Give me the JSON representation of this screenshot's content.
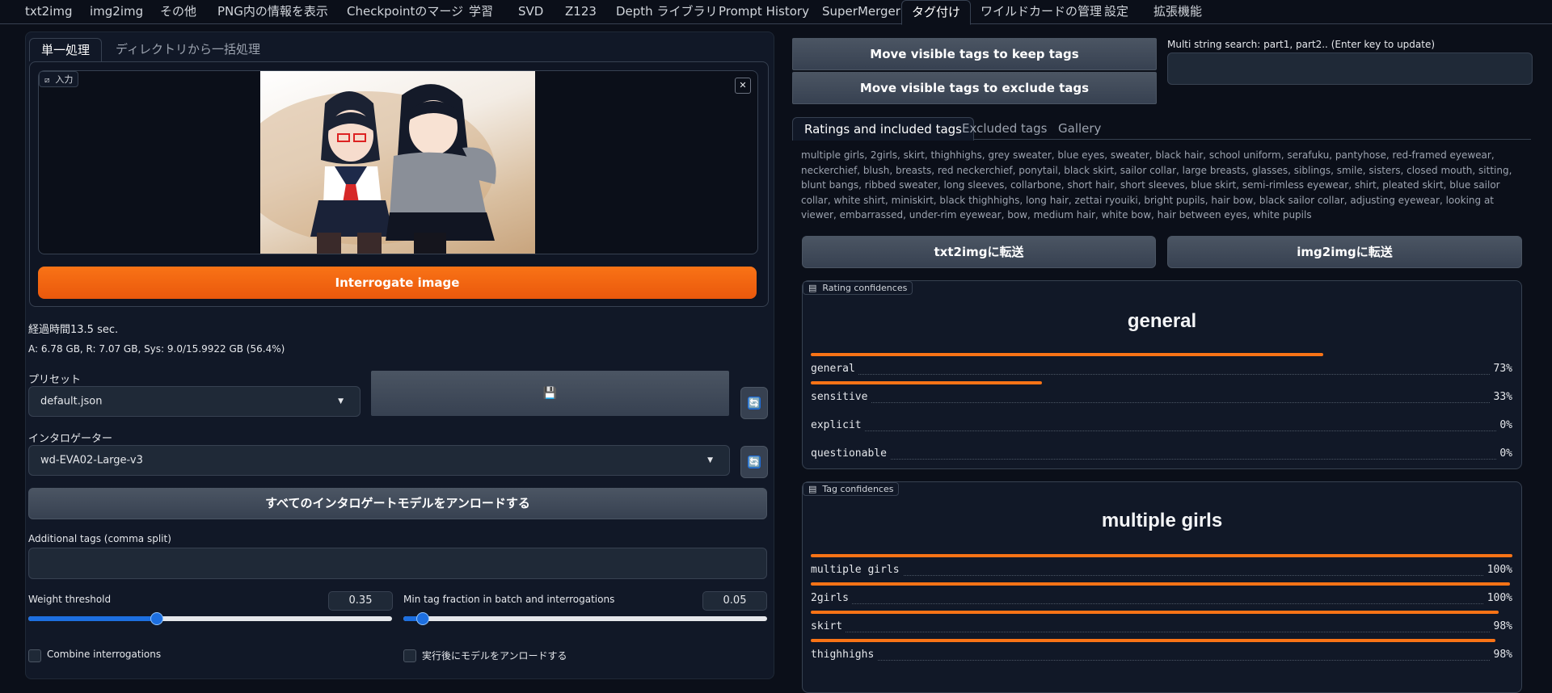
{
  "nav": {
    "tabs": [
      "txt2img",
      "img2img",
      "その他",
      "PNG内の情報を表示",
      "Checkpointのマージ",
      "学習",
      "SVD",
      "Z123",
      "Depth ライブラリ",
      "Prompt History",
      "SuperMerger",
      "タグ付け",
      "ワイルドカードの管理",
      "設定",
      "拡張機能"
    ],
    "active": "タグ付け"
  },
  "left": {
    "subtabs": [
      "単一処理",
      "ディレクトリから一括処理"
    ],
    "image_label": "入力",
    "image_close": "✕",
    "interrogate": "Interrogate image",
    "elapsed": "経過時間13.5 sec.",
    "mem": "A: 6.78 GB, R: 7.07 GB, Sys: 9.0/15.9922 GB (56.4%)",
    "preset_label": "プリセット",
    "preset_value": "default.json",
    "save_icon": "💾",
    "interrogator_label": "インタロゲーター",
    "interrogator_value": "wd-EVA02-Large-v3",
    "refresh_icon": "🔄",
    "unload_all": "すべてのインタロゲートモデルをアンロードする",
    "additional_tags_label": "Additional tags (comma split)",
    "weight_label": "Weight threshold",
    "weight_value": "0.35",
    "weight_level": 0.35,
    "min_frac_label": "Min tag fraction in batch and interrogations",
    "min_frac_value": "0.05",
    "min_frac_level": 0.05,
    "combine_label": "Combine interrogations",
    "unload_after_label": "実行後にモデルをアンロードする"
  },
  "right": {
    "move_keep": "Move visible tags to keep tags",
    "move_exclude": "Move visible tags to exclude tags",
    "search_label": "Multi string search: part1, part2.. (Enter key to update)",
    "tabs": [
      "Ratings and included tags",
      "Excluded tags",
      "Gallery"
    ],
    "tags_text": "multiple girls, 2girls, skirt, thighhighs, grey sweater, blue eyes, sweater, black hair, school uniform, serafuku, pantyhose, red-framed eyewear, neckerchief, blush, breasts, red neckerchief, ponytail, black skirt, sailor collar, large breasts, glasses, siblings, smile, sisters, closed mouth, sitting, blunt bangs, ribbed sweater, long sleeves, collarbone, short hair, short sleeves, blue skirt, semi-rimless eyewear, shirt, pleated skirt, blue sailor collar, white shirt, miniskirt, black thighhighs, long hair, zettai ryouiki, bright pupils, hair bow, black sailor collar, adjusting eyewear, looking at viewer, embarrassed, under-rim eyewear, bow, medium hair, white bow, hair between eyes, white pupils",
    "to_txt2img": "txt2imgに転送",
    "to_img2img": "img2imgに転送",
    "rating": {
      "label": "Rating confidences",
      "top": "general",
      "rows": [
        {
          "name": "general",
          "pct": "73%",
          "value": 0.73
        },
        {
          "name": "sensitive",
          "pct": "33%",
          "value": 0.33
        },
        {
          "name": "explicit",
          "pct": "0%",
          "value": 0.0
        },
        {
          "name": "questionable",
          "pct": "0%",
          "value": 0.0
        }
      ]
    },
    "tags": {
      "label": "Tag confidences",
      "top": "multiple girls",
      "rows": [
        {
          "name": "multiple girls",
          "pct": "100%",
          "value": 1.0
        },
        {
          "name": "2girls",
          "pct": "100%",
          "value": 0.997
        },
        {
          "name": "skirt",
          "pct": "98%",
          "value": 0.98
        },
        {
          "name": "thighhighs",
          "pct": "98%",
          "value": 0.976
        }
      ]
    }
  }
}
